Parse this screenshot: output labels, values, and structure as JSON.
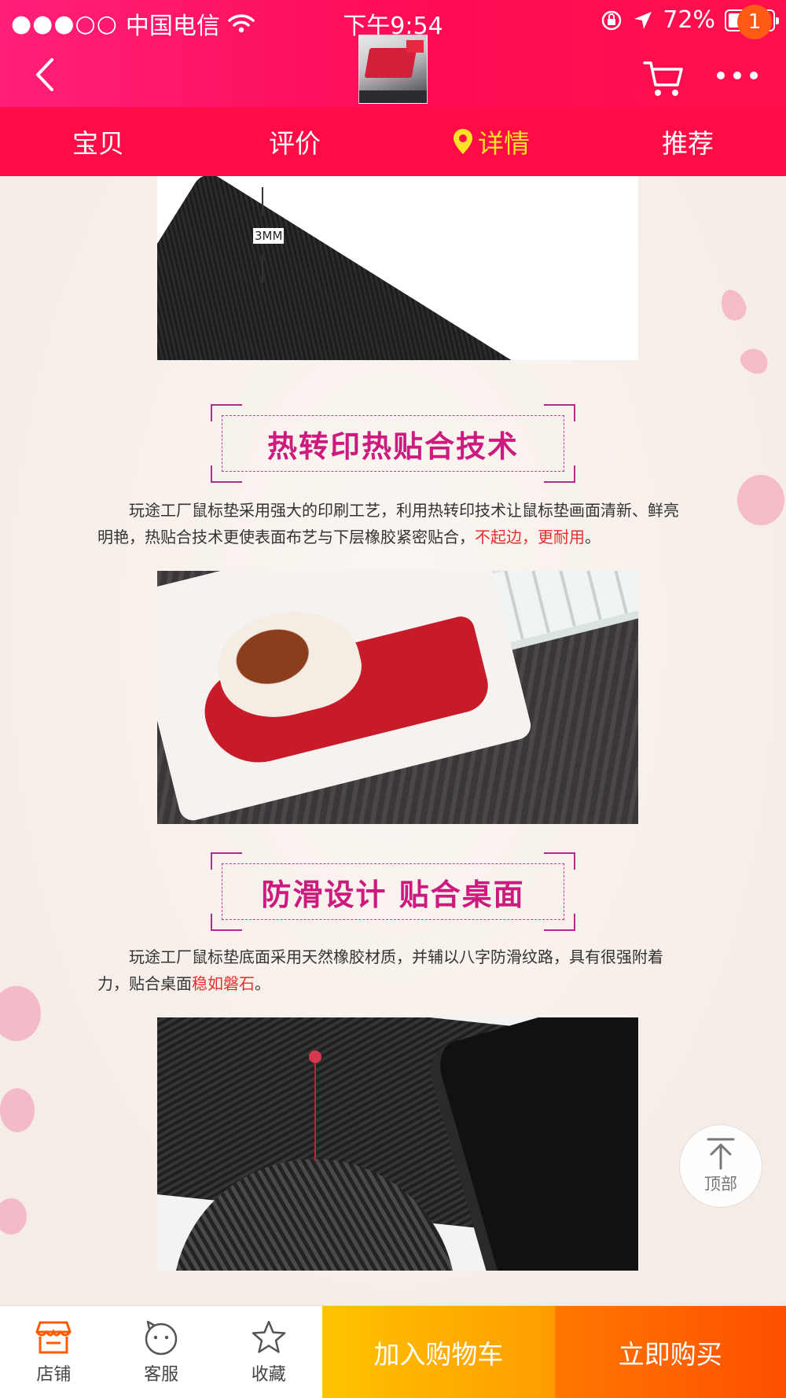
{
  "status_bar": {
    "signal": "●●●○○",
    "carrier": "中国电信",
    "time": "下午9:54",
    "battery_percent": "72%",
    "battery_level": 0.72
  },
  "header": {
    "cart_badge": "1"
  },
  "tabs": [
    {
      "label": "宝贝",
      "active": false
    },
    {
      "label": "评价",
      "active": false
    },
    {
      "label": "详情",
      "active": true
    },
    {
      "label": "推荐",
      "active": false
    }
  ],
  "content": {
    "mm_label": "3MM",
    "section1": {
      "heading": "热转印热贴合技术",
      "paragraph_start": "玩途工厂鼠标垫采用强大的印刷工艺，利用热转印技术让鼠标垫画面清新、鲜亮明艳，热贴合技术更使表面布艺与下层橡胶紧密贴合，",
      "paragraph_highlight": "不起边，更耐用",
      "paragraph_end": "。"
    },
    "section2": {
      "heading": "防滑设计 贴合桌面",
      "paragraph_start": "玩途工厂鼠标垫底面采用天然橡胶材质，并辅以八字防滑纹路，具有很强附着力，贴合桌面",
      "paragraph_highlight": "稳如磐石",
      "paragraph_end": "。"
    },
    "back_to_top_label": "顶部"
  },
  "bottom_bar": {
    "shop_label": "店铺",
    "service_label": "客服",
    "favorite_label": "收藏",
    "add_to_cart_label": "加入购物车",
    "buy_now_label": "立即购买"
  },
  "colors": {
    "header_pink": "#ff0b55",
    "active_tab": "#ffe12a",
    "heading_magenta": "#cc1a7e",
    "highlight_red": "#e62e2e",
    "add_cart_yellow": "#ffc300",
    "buy_now_orange": "#ff5a00"
  }
}
